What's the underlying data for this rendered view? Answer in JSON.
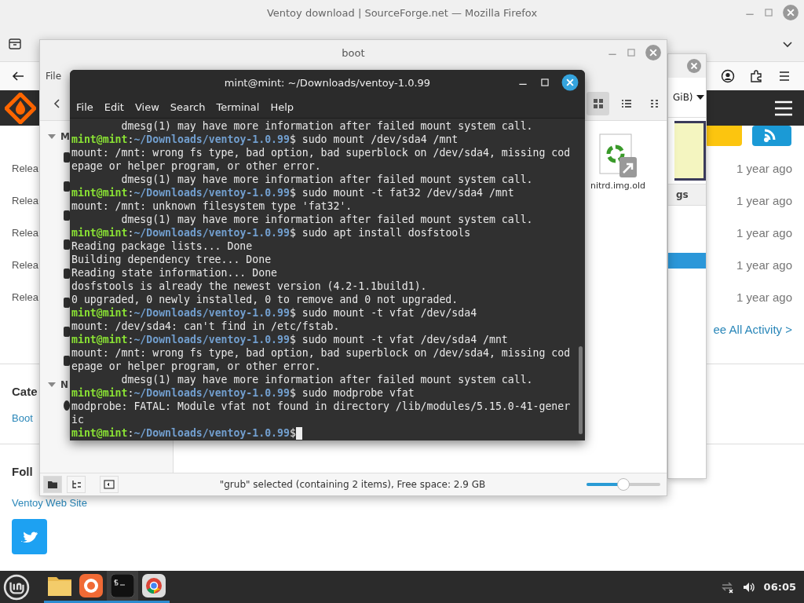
{
  "firefox": {
    "title": "Ventoy download | SourceForge.net — Mozilla Firefox",
    "activity": [
      {
        "label": "Relea",
        "time": "1 year ago"
      },
      {
        "label": "Relea",
        "time": "1 year ago"
      },
      {
        "label": "Relea",
        "time": "1 year ago"
      },
      {
        "label": "Relea",
        "time": "1 year ago"
      },
      {
        "label": "Relea",
        "time": "1 year ago"
      }
    ],
    "see_all": "ee All Activity >",
    "categories_heading": "Cate",
    "category_link": "Boot",
    "follow_heading": "Foll",
    "web_site_link": "Ventoy Web Site"
  },
  "back_window": {
    "size_label": "GiB)",
    "column_label": "gs"
  },
  "file_manager": {
    "title": "boot",
    "menu": [
      "File"
    ],
    "sidebar_sections": [
      "M",
      "N"
    ],
    "view_buttons": [
      {
        "kind": "grid",
        "selected": true
      },
      {
        "kind": "list",
        "selected": false
      },
      {
        "kind": "compact",
        "selected": false
      }
    ],
    "files": [
      {
        "name": "nitrd.img.old"
      }
    ],
    "sidebar_modes": [
      {
        "kind": "places",
        "selected": true
      },
      {
        "kind": "tree",
        "selected": false
      }
    ],
    "status": "\"grub\" selected (containing 2 items), Free space: 2.9 GB",
    "zoom": {
      "level": 0.5
    }
  },
  "terminal": {
    "title": "mint@mint: ~/Downloads/ventoy-1.0.99",
    "menu": [
      "File",
      "Edit",
      "View",
      "Search",
      "Terminal",
      "Help"
    ],
    "lines": [
      {
        "kind": "output",
        "text": "        dmesg(1) may have more information after failed mount system call."
      },
      {
        "kind": "prompt",
        "user": "mint@mint",
        "sep": ":",
        "path": "~/Downloads/ventoy-1.0.99",
        "command": "$ sudo mount /dev/sda4 /mnt"
      },
      {
        "kind": "output",
        "text": "mount: /mnt: wrong fs type, bad option, bad superblock on /dev/sda4, missing cod"
      },
      {
        "kind": "output",
        "text": "epage or helper program, or other error."
      },
      {
        "kind": "output",
        "text": "        dmesg(1) may have more information after failed mount system call."
      },
      {
        "kind": "prompt",
        "user": "mint@mint",
        "sep": ":",
        "path": "~/Downloads/ventoy-1.0.99",
        "command": "$ sudo mount -t fat32 /dev/sda4 /mnt"
      },
      {
        "kind": "output",
        "text": "mount: /mnt: unknown filesystem type 'fat32'."
      },
      {
        "kind": "output",
        "text": "        dmesg(1) may have more information after failed mount system call."
      },
      {
        "kind": "prompt",
        "user": "mint@mint",
        "sep": ":",
        "path": "~/Downloads/ventoy-1.0.99",
        "command": "$ sudo apt install dosfstools"
      },
      {
        "kind": "output",
        "text": "Reading package lists... Done"
      },
      {
        "kind": "output",
        "text": "Building dependency tree... Done"
      },
      {
        "kind": "output",
        "text": "Reading state information... Done"
      },
      {
        "kind": "output",
        "text": "dosfstools is already the newest version (4.2-1.1build1)."
      },
      {
        "kind": "output",
        "text": "0 upgraded, 0 newly installed, 0 to remove and 0 not upgraded."
      },
      {
        "kind": "prompt",
        "user": "mint@mint",
        "sep": ":",
        "path": "~/Downloads/ventoy-1.0.99",
        "command": "$ sudo mount -t vfat /dev/sda4"
      },
      {
        "kind": "output",
        "text": "mount: /dev/sda4: can't find in /etc/fstab."
      },
      {
        "kind": "prompt",
        "user": "mint@mint",
        "sep": ":",
        "path": "~/Downloads/ventoy-1.0.99",
        "command": "$ sudo mount -t vfat /dev/sda4 /mnt"
      },
      {
        "kind": "output",
        "text": "mount: /mnt: wrong fs type, bad option, bad superblock on /dev/sda4, missing cod"
      },
      {
        "kind": "output",
        "text": "epage or helper program, or other error."
      },
      {
        "kind": "output",
        "text": "        dmesg(1) may have more information after failed mount system call."
      },
      {
        "kind": "prompt",
        "user": "mint@mint",
        "sep": ":",
        "path": "~/Downloads/ventoy-1.0.99",
        "command": "$ sudo modprobe vfat"
      },
      {
        "kind": "output",
        "text": "modprobe: FATAL: Module vfat not found in directory /lib/modules/5.15.0-41-gener"
      },
      {
        "kind": "output",
        "text": "ic"
      },
      {
        "kind": "prompt",
        "user": "mint@mint",
        "sep": ":",
        "path": "~/Downloads/ventoy-1.0.99",
        "command": "$",
        "cursor": true
      }
    ]
  },
  "taskbar": {
    "apps": [
      {
        "kind": "files",
        "selected": false
      },
      {
        "kind": "firefox",
        "selected": false
      },
      {
        "kind": "terminal",
        "selected": true
      },
      {
        "kind": "chrome",
        "selected": false
      }
    ],
    "clock": "06:05"
  }
}
